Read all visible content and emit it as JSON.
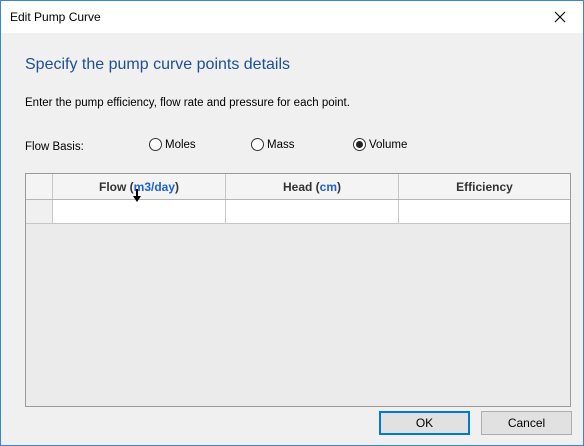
{
  "window": {
    "title": "Edit Pump Curve"
  },
  "heading": "Specify the pump curve points details",
  "instructions": "Enter the pump efficiency, flow rate and pressure for each point.",
  "flow_basis": {
    "label": "Flow Basis:",
    "options": [
      {
        "label": "Moles",
        "selected": false
      },
      {
        "label": "Mass",
        "selected": false
      },
      {
        "label": "Volume",
        "selected": true
      }
    ]
  },
  "grid": {
    "columns": [
      {
        "name": "Flow",
        "unit": "m3/day"
      },
      {
        "name": "Head",
        "unit": "cm"
      },
      {
        "name": "Efficiency",
        "unit": ""
      }
    ],
    "rows": [
      [
        "",
        "",
        ""
      ]
    ]
  },
  "buttons": {
    "ok": "OK",
    "cancel": "Cancel"
  },
  "colors": {
    "heading": "#1f4e9b",
    "unit": "#1a60d6",
    "accent_border": "#0078d7"
  },
  "icons": {
    "close": "close-icon",
    "cursor": "mouse-cursor-icon"
  }
}
